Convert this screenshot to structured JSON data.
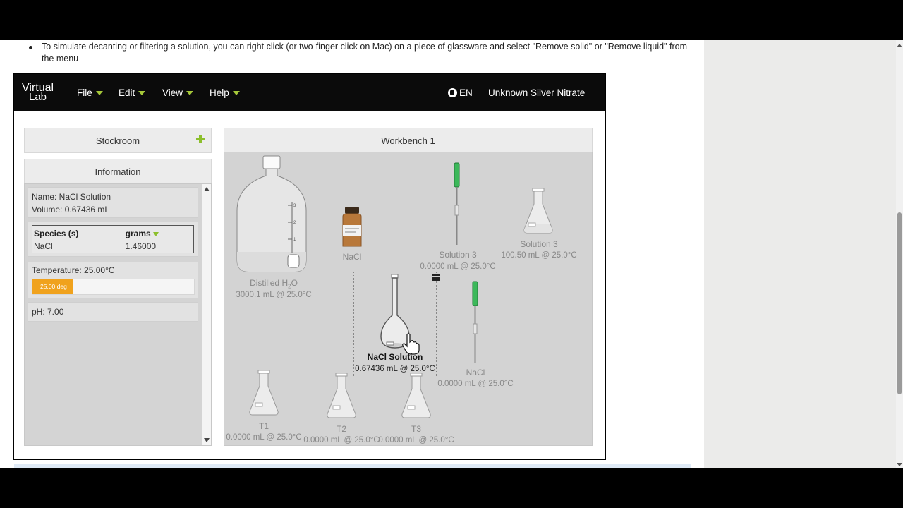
{
  "instructions": {
    "bullet": "To simulate decanting or filtering a solution, you can right click (or two-finger click on Mac) on a piece of glassware and select \"Remove solid\" or \"Remove liquid\" from the menu"
  },
  "app": {
    "logo_line1": "Virtual",
    "logo_line2": "Lab",
    "menus": [
      {
        "label": "File"
      },
      {
        "label": "Edit"
      },
      {
        "label": "View"
      },
      {
        "label": "Help"
      }
    ],
    "language": "EN",
    "assignment": "Unknown Silver Nitrate",
    "accent_color": "#a6c83a"
  },
  "stockroom": {
    "title": "Stockroom",
    "add_icon": "plus-icon"
  },
  "information": {
    "title": "Information",
    "name_line": "Name: NaCl Solution",
    "volume_line": "Volume: 0.67436 mL",
    "species_header": "Species (s)",
    "grams_header": "grams",
    "species": [
      {
        "name": "NaCl",
        "grams": "1.46000"
      }
    ],
    "temperature_line": "Temperature: 25.00°C",
    "temperature_bar_label": "25.00 deg",
    "temperature_bar_fraction": 0.25,
    "ph_line": "pH: 7.00"
  },
  "workbench": {
    "title": "Workbench 1",
    "items": {
      "carboy": {
        "name": "Distilled H",
        "sub": "2",
        "name_tail": "O",
        "detail": "3000.1 mL @ 25.0°C"
      },
      "bottle": {
        "name": "NaCl"
      },
      "pipette1": {
        "name": "Solution 3",
        "detail": "0.0000 mL @ 25.0°C"
      },
      "flask_s3": {
        "name": "Solution 3",
        "detail": "100.50 mL @ 25.0°C"
      },
      "volumetric": {
        "name": "NaCl Solution",
        "detail": "0.67436 mL @ 25.0°C"
      },
      "pipette2": {
        "name": "NaCl",
        "detail": "0.0000 mL @ 25.0°C"
      },
      "t1": {
        "name": "T1",
        "detail": "0.0000 mL @ 25.0°C"
      },
      "t2": {
        "name": "T2",
        "detail": "0.0000 mL @ 25.0°C"
      },
      "t3": {
        "name": "T3",
        "detail": "0.0000 mL @ 25.0°C"
      }
    }
  }
}
